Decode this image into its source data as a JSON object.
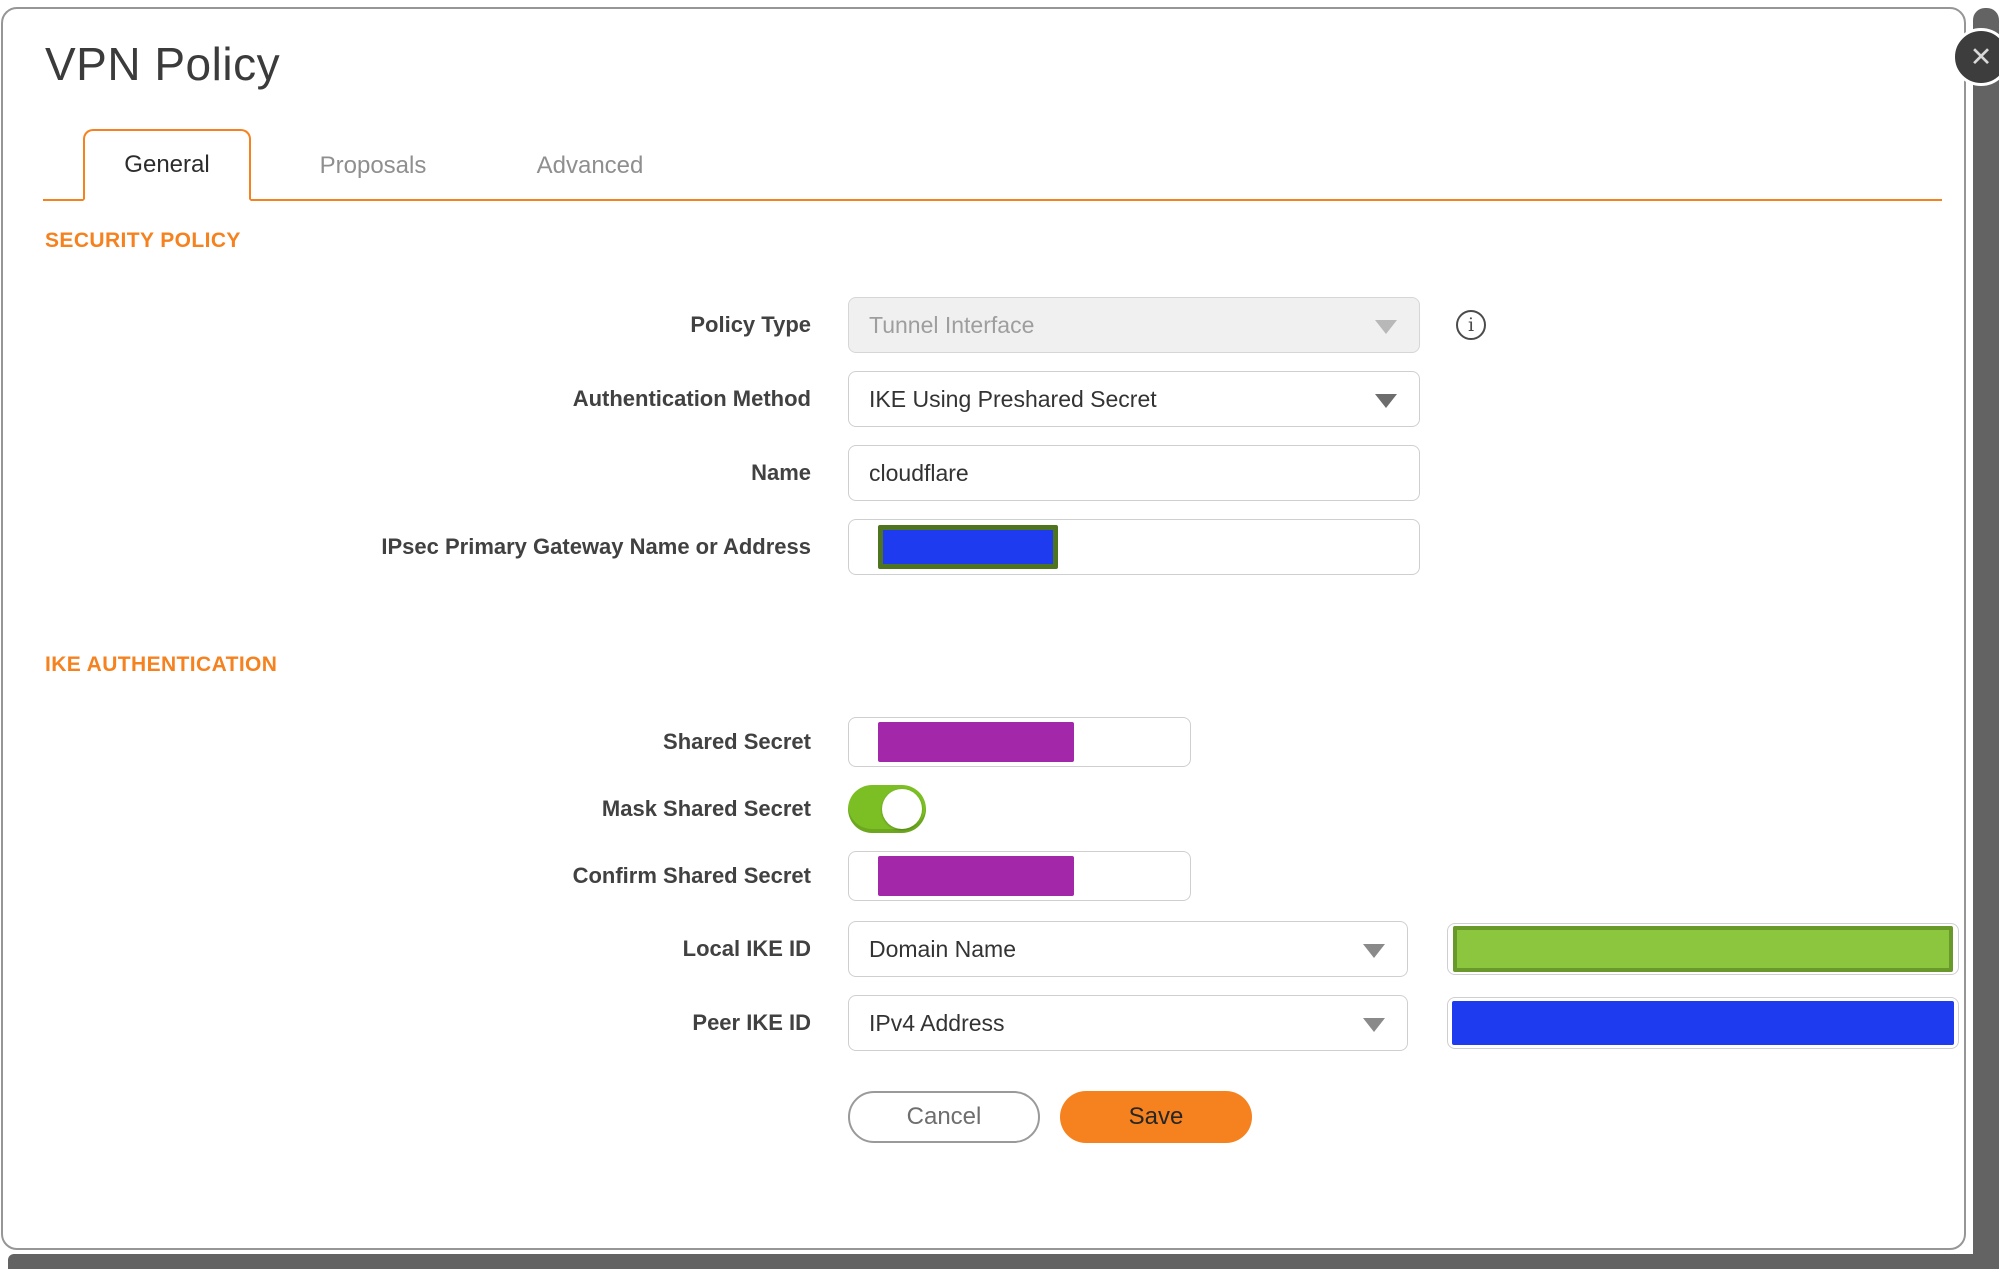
{
  "colors": {
    "accent": "#f5821f",
    "toggle_green": "#7cbf24",
    "redaction_purple": "#a228a9",
    "redaction_blue": "#1f3bf0",
    "redaction_green": "#8cc63f",
    "redaction_green_border": "#69982b",
    "redaction_olive_border": "#4e741f",
    "backdrop": "#636363"
  },
  "header": {
    "title": "VPN Policy",
    "close_glyph": "✕"
  },
  "tabs": [
    {
      "label": "General",
      "active": true
    },
    {
      "label": "Proposals",
      "active": false
    },
    {
      "label": "Advanced",
      "active": false
    }
  ],
  "security_policy": {
    "heading": "SECURITY POLICY",
    "policy_type": {
      "label": "Policy Type",
      "value": "Tunnel Interface",
      "disabled": true,
      "info_glyph": "i"
    },
    "authentication_method": {
      "label": "Authentication Method",
      "value": "IKE Using Preshared Secret"
    },
    "name": {
      "label": "Name",
      "value": "cloudflare"
    },
    "gateway": {
      "label": "IPsec Primary Gateway Name or Address",
      "value_state": "redacted-blue"
    }
  },
  "ike_authentication": {
    "heading": "IKE AUTHENTICATION",
    "shared_secret": {
      "label": "Shared Secret",
      "value_state": "redacted-purple"
    },
    "mask_shared_secret": {
      "label": "Mask Shared Secret",
      "state": "on"
    },
    "confirm_shared_secret": {
      "label": "Confirm Shared Secret",
      "value_state": "redacted-purple"
    },
    "local_ike_id": {
      "label": "Local IKE ID",
      "type": "Domain Name",
      "value_state": "redacted-green"
    },
    "peer_ike_id": {
      "label": "Peer IKE ID",
      "type": "IPv4 Address",
      "value_state": "redacted-blue"
    }
  },
  "footer": {
    "cancel_label": "Cancel",
    "save_label": "Save"
  }
}
